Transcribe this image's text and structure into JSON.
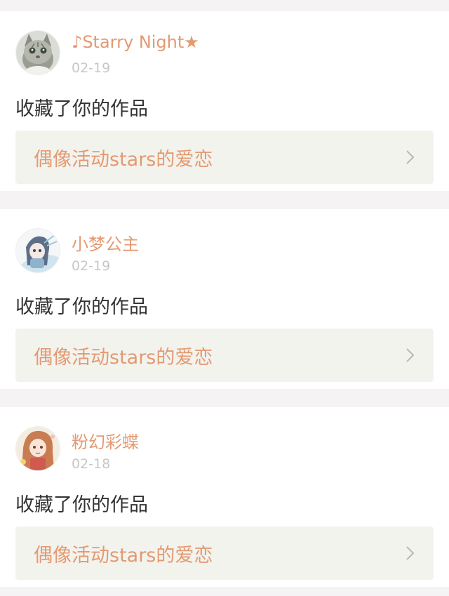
{
  "notifications": [
    {
      "user": "♪Starry Night★",
      "date": "02-19",
      "action": "收藏了你的作品",
      "work": "偶像活动stars的爱恋",
      "avatar_icon": "cat-avatar"
    },
    {
      "user": "小梦公主",
      "date": "02-19",
      "action": "收藏了你的作品",
      "work": "偶像活动stars的爱恋",
      "avatar_icon": "anime-girl-avatar"
    },
    {
      "user": "粉幻彩蝶",
      "date": "02-18",
      "action": "收藏了你的作品",
      "work": "偶像活动stars的爱恋",
      "avatar_icon": "anime-girl-avatar"
    }
  ],
  "colors": {
    "accent": "#e39a72",
    "background": "#f5f3f3",
    "row_bg": "#f3f3ee"
  }
}
